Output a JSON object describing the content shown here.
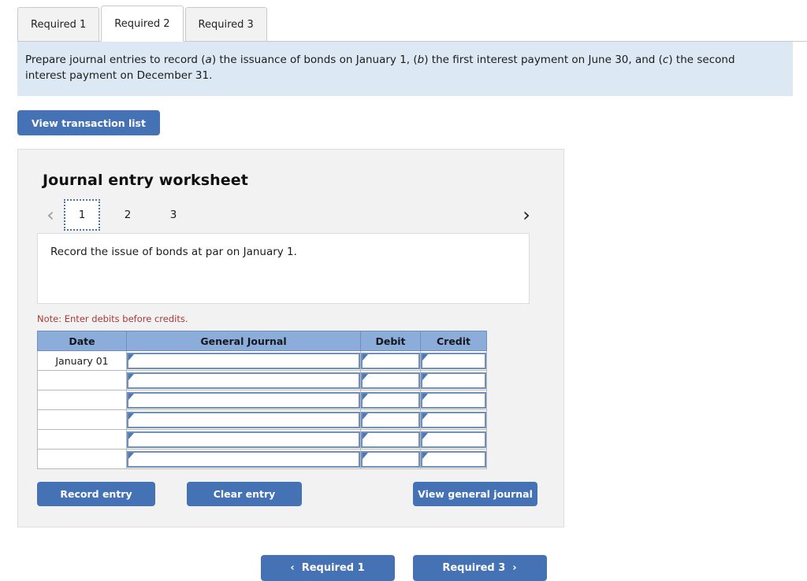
{
  "tabs": [
    {
      "label": "Required 1",
      "active": false
    },
    {
      "label": "Required 2",
      "active": true
    },
    {
      "label": "Required 3",
      "active": false
    }
  ],
  "banner": {
    "part1": "Prepare journal entries to record (",
    "a": "a",
    "part2": ") the issuance of bonds on January 1, (",
    "b": "b",
    "part3": ") the first interest payment on June 30, and (",
    "c": "c",
    "part4": ") the second interest payment on December 31."
  },
  "toolbar": {
    "view_transaction_list_label": "View transaction list"
  },
  "worksheet": {
    "title": "Journal entry worksheet",
    "pager": {
      "prev_icon": "‹",
      "next_icon": "›",
      "pages": [
        "1",
        "2",
        "3"
      ],
      "active_page": "1"
    },
    "prompt": "Record the issue of bonds at par on January 1.",
    "note": "Note: Enter debits before credits.",
    "table": {
      "columns": [
        "Date",
        "General Journal",
        "Debit",
        "Credit"
      ],
      "rows": [
        {
          "date": "January 01",
          "general_journal": "",
          "debit": "",
          "credit": ""
        },
        {
          "date": "",
          "general_journal": "",
          "debit": "",
          "credit": ""
        },
        {
          "date": "",
          "general_journal": "",
          "debit": "",
          "credit": ""
        },
        {
          "date": "",
          "general_journal": "",
          "debit": "",
          "credit": ""
        },
        {
          "date": "",
          "general_journal": "",
          "debit": "",
          "credit": ""
        },
        {
          "date": "",
          "general_journal": "",
          "debit": "",
          "credit": ""
        }
      ]
    },
    "actions": {
      "record_entry_label": "Record entry",
      "clear_entry_label": "Clear entry",
      "view_general_journal_label": "View general journal"
    }
  },
  "bottom_nav": {
    "prev_icon": "‹",
    "prev_label": "Required 1",
    "next_label": "Required 3",
    "next_icon": "›"
  },
  "colors": {
    "accent_blue": "#4472b4",
    "banner_blue": "#dce8f4",
    "table_header_blue": "#8cacd9",
    "note_red": "#a63a3a",
    "panel_gray": "#f2f2f2"
  }
}
